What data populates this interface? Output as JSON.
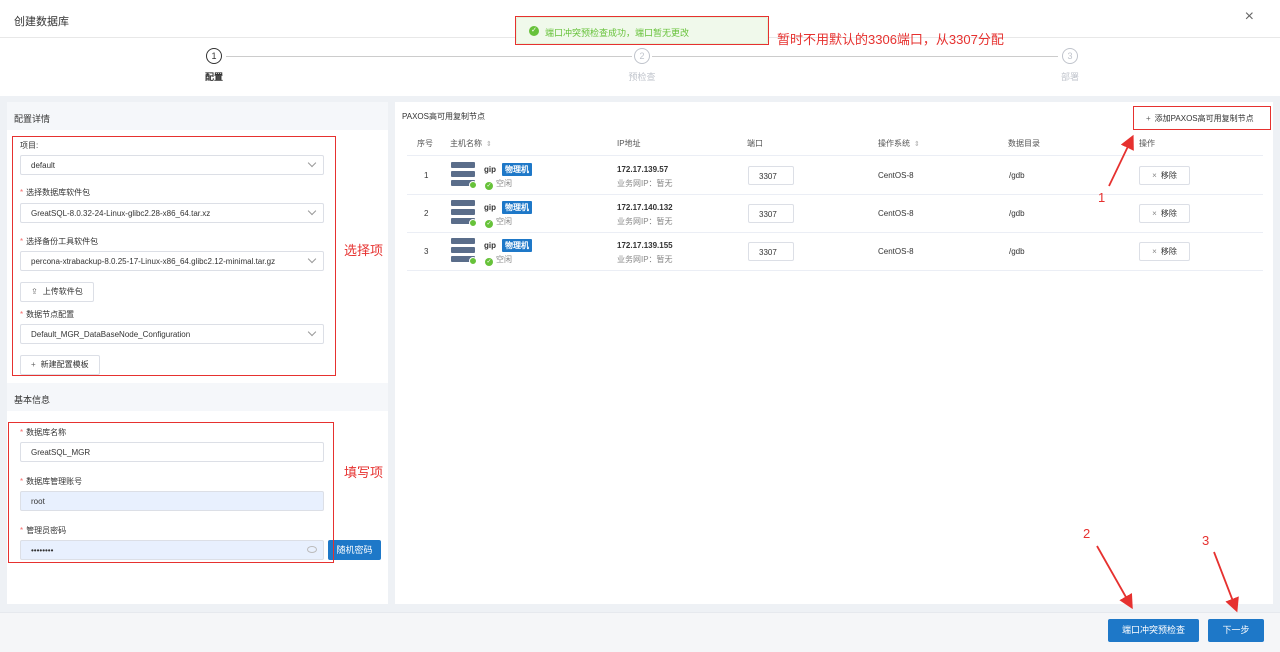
{
  "dialog": {
    "title": "创建数据库",
    "close_icon": "×"
  },
  "toast": {
    "message": "端口冲突预检查成功，端口暂无更改",
    "icon": "check-circle-icon",
    "color": "#67c23a"
  },
  "annotations": {
    "port_note": "暂时不用默认的3306端口，从3307分配",
    "select_note": "选择项",
    "fill_note": "填写项",
    "num1": "1",
    "num2": "2",
    "num3": "3",
    "color": "#e6312f"
  },
  "steps": [
    {
      "number": "1",
      "label": "配置",
      "state": "active"
    },
    {
      "number": "2",
      "label": "预检查",
      "state": "inactive"
    },
    {
      "number": "3",
      "label": "部署",
      "state": "inactive"
    }
  ],
  "config": {
    "section_title": "配置详情",
    "project_label": "项目",
    "project_value": "default",
    "package_label": "选择数据库软件包",
    "package_value": "GreatSQL-8.0.32-24-Linux-glibc2.28-x86_64.tar.xz",
    "backup_label": "选择备份工具软件包",
    "backup_value": "percona-xtrabackup-8.0.25-17-Linux-x86_64.glibc2.12-minimal.tar.gz",
    "upload_label": "上传软件包",
    "node_config_label": "数据节点配置",
    "node_config_value": "Default_MGR_DataBaseNode_Configuration",
    "new_template_label": "新建配置模板"
  },
  "basic": {
    "section_title": "基本信息",
    "db_name_label": "数据库名称",
    "db_name_value": "GreatSQL_MGR",
    "admin_label": "数据库管理账号",
    "admin_value": "root",
    "password_label": "管理员密码",
    "password_value": "••••••••",
    "random_password_label": "随机密码"
  },
  "nodes": {
    "title": "PAXOS高可用复制节点",
    "add_label": "添加PAXOS高可用复制节点",
    "columns": [
      "序号",
      "主机名称",
      "IP地址",
      "端口",
      "操作系统",
      "数据目录",
      "操作"
    ],
    "rows": [
      {
        "index": "1",
        "host": "gip",
        "tag": "物理机",
        "status": "空闲",
        "ip": "172.17.139.57",
        "ip_sub": "业务网IP：暂无",
        "port": "3307",
        "os": "CentOS-8",
        "dir": "/gdb",
        "remove": "移除"
      },
      {
        "index": "2",
        "host": "gip",
        "tag": "物理机",
        "status": "空闲",
        "ip": "172.17.140.132",
        "ip_sub": "业务网IP：暂无",
        "port": "3307",
        "os": "CentOS-8",
        "dir": "/gdb",
        "remove": "移除"
      },
      {
        "index": "3",
        "host": "gip",
        "tag": "物理机",
        "status": "空闲",
        "ip": "172.17.139.155",
        "ip_sub": "业务网IP：暂无",
        "port": "3307",
        "os": "CentOS-8",
        "dir": "/gdb",
        "remove": "移除"
      }
    ]
  },
  "footer": {
    "precheck_label": "端口冲突预检查",
    "next_label": "下一步"
  },
  "colors": {
    "primary": "#1e78c8",
    "success": "#67c23a",
    "danger": "#f56c6c"
  }
}
